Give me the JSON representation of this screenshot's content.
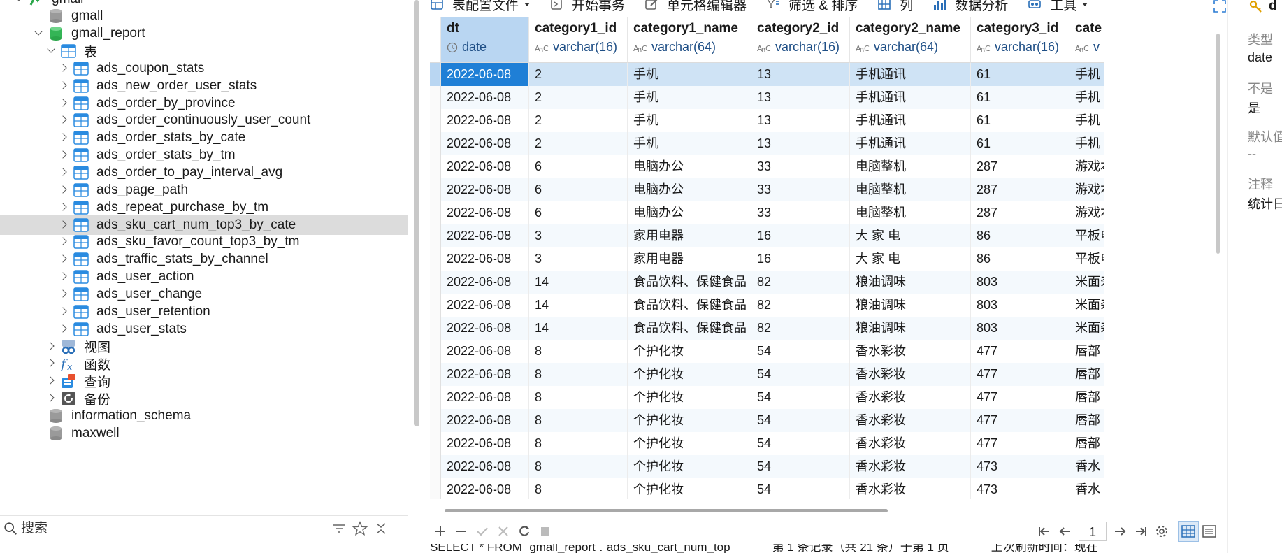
{
  "navigator": {
    "items": [
      {
        "label": "gmall",
        "level": 0,
        "icon": "connection-icon",
        "chevron": "down",
        "partial": true
      },
      {
        "label": "gmall",
        "level": 1,
        "icon": "database-icon",
        "chevron": "none"
      },
      {
        "label": "gmall_report",
        "level": 1,
        "icon": "database-active-icon",
        "chevron": "down"
      },
      {
        "label": "表",
        "level": 2,
        "icon": "tables-folder-icon",
        "chevron": "down"
      },
      {
        "label": "ads_coupon_stats",
        "level": 3,
        "icon": "table-icon",
        "chevron": "right"
      },
      {
        "label": "ads_new_order_user_stats",
        "level": 3,
        "icon": "table-icon",
        "chevron": "right"
      },
      {
        "label": "ads_order_by_province",
        "level": 3,
        "icon": "table-icon",
        "chevron": "right"
      },
      {
        "label": "ads_order_continuously_user_count",
        "level": 3,
        "icon": "table-icon",
        "chevron": "right"
      },
      {
        "label": "ads_order_stats_by_cate",
        "level": 3,
        "icon": "table-icon",
        "chevron": "right"
      },
      {
        "label": "ads_order_stats_by_tm",
        "level": 3,
        "icon": "table-icon",
        "chevron": "right"
      },
      {
        "label": "ads_order_to_pay_interval_avg",
        "level": 3,
        "icon": "table-icon",
        "chevron": "right"
      },
      {
        "label": "ads_page_path",
        "level": 3,
        "icon": "table-icon",
        "chevron": "right"
      },
      {
        "label": "ads_repeat_purchase_by_tm",
        "level": 3,
        "icon": "table-icon",
        "chevron": "right"
      },
      {
        "label": "ads_sku_cart_num_top3_by_cate",
        "level": 3,
        "icon": "table-icon",
        "chevron": "right",
        "selected": true
      },
      {
        "label": "ads_sku_favor_count_top3_by_tm",
        "level": 3,
        "icon": "table-icon",
        "chevron": "right"
      },
      {
        "label": "ads_traffic_stats_by_channel",
        "level": 3,
        "icon": "table-icon",
        "chevron": "right"
      },
      {
        "label": "ads_user_action",
        "level": 3,
        "icon": "table-icon",
        "chevron": "right"
      },
      {
        "label": "ads_user_change",
        "level": 3,
        "icon": "table-icon",
        "chevron": "right"
      },
      {
        "label": "ads_user_retention",
        "level": 3,
        "icon": "table-icon",
        "chevron": "right"
      },
      {
        "label": "ads_user_stats",
        "level": 3,
        "icon": "table-icon",
        "chevron": "right"
      },
      {
        "label": "视图",
        "level": 2,
        "icon": "views-icon",
        "chevron": "right"
      },
      {
        "label": "函数",
        "level": 2,
        "icon": "function-icon",
        "chevron": "right"
      },
      {
        "label": "查询",
        "level": 2,
        "icon": "query-icon",
        "chevron": "right"
      },
      {
        "label": "备份",
        "level": 2,
        "icon": "backup-icon",
        "chevron": "right"
      },
      {
        "label": "information_schema",
        "level": 1,
        "icon": "database-icon",
        "chevron": "none"
      },
      {
        "label": "maxwell",
        "level": 1,
        "icon": "database-icon",
        "chevron": "none"
      }
    ],
    "search_placeholder": "搜索"
  },
  "toolbar": {
    "items": [
      {
        "label": "表配置文件",
        "icon": "table-config-icon",
        "dropdown": true
      },
      {
        "label": "开始事务",
        "icon": "transaction-icon",
        "dropdown": false
      },
      {
        "label": "单元格编辑器",
        "icon": "cell-editor-icon",
        "dropdown": false
      },
      {
        "label": "筛选 & 排序",
        "icon": "filter-sort-icon",
        "dropdown": false
      },
      {
        "label": "列",
        "icon": "columns-icon",
        "dropdown": false
      },
      {
        "label": "数据分析",
        "icon": "data-analysis-icon",
        "dropdown": false
      },
      {
        "label": "工具",
        "icon": "tools-icon",
        "dropdown": true
      }
    ]
  },
  "grid": {
    "columns": [
      {
        "name": "dt",
        "type": "date",
        "type_icon": "clock-icon"
      },
      {
        "name": "category1_id",
        "type": "varchar(16)",
        "type_icon": "abc-icon"
      },
      {
        "name": "category1_name",
        "type": "varchar(64)",
        "type_icon": "abc-icon"
      },
      {
        "name": "category2_id",
        "type": "varchar(16)",
        "type_icon": "abc-icon"
      },
      {
        "name": "category2_name",
        "type": "varchar(64)",
        "type_icon": "abc-icon"
      },
      {
        "name": "category3_id",
        "type": "varchar(16)",
        "type_icon": "abc-icon"
      },
      {
        "name": "cate",
        "type": "v",
        "type_icon": "abc-icon"
      }
    ],
    "rows": [
      [
        "2022-06-08",
        "2",
        "手机",
        "13",
        "手机通讯",
        "61",
        "手机"
      ],
      [
        "2022-06-08",
        "2",
        "手机",
        "13",
        "手机通讯",
        "61",
        "手机"
      ],
      [
        "2022-06-08",
        "2",
        "手机",
        "13",
        "手机通讯",
        "61",
        "手机"
      ],
      [
        "2022-06-08",
        "2",
        "手机",
        "13",
        "手机通讯",
        "61",
        "手机"
      ],
      [
        "2022-06-08",
        "6",
        "电脑办公",
        "33",
        "电脑整机",
        "287",
        "游戏本"
      ],
      [
        "2022-06-08",
        "6",
        "电脑办公",
        "33",
        "电脑整机",
        "287",
        "游戏本"
      ],
      [
        "2022-06-08",
        "6",
        "电脑办公",
        "33",
        "电脑整机",
        "287",
        "游戏本"
      ],
      [
        "2022-06-08",
        "3",
        "家用电器",
        "16",
        "大 家 电",
        "86",
        "平板电"
      ],
      [
        "2022-06-08",
        "3",
        "家用电器",
        "16",
        "大 家 电",
        "86",
        "平板电"
      ],
      [
        "2022-06-08",
        "14",
        "食品饮料、保健食品",
        "82",
        "粮油调味",
        "803",
        "米面杂"
      ],
      [
        "2022-06-08",
        "14",
        "食品饮料、保健食品",
        "82",
        "粮油调味",
        "803",
        "米面杂"
      ],
      [
        "2022-06-08",
        "14",
        "食品饮料、保健食品",
        "82",
        "粮油调味",
        "803",
        "米面杂"
      ],
      [
        "2022-06-08",
        "8",
        "个护化妆",
        "54",
        "香水彩妆",
        "477",
        "唇部"
      ],
      [
        "2022-06-08",
        "8",
        "个护化妆",
        "54",
        "香水彩妆",
        "477",
        "唇部"
      ],
      [
        "2022-06-08",
        "8",
        "个护化妆",
        "54",
        "香水彩妆",
        "477",
        "唇部"
      ],
      [
        "2022-06-08",
        "8",
        "个护化妆",
        "54",
        "香水彩妆",
        "477",
        "唇部"
      ],
      [
        "2022-06-08",
        "8",
        "个护化妆",
        "54",
        "香水彩妆",
        "477",
        "唇部"
      ],
      [
        "2022-06-08",
        "8",
        "个护化妆",
        "54",
        "香水彩妆",
        "473",
        "香水"
      ],
      [
        "2022-06-08",
        "8",
        "个护化妆",
        "54",
        "香水彩妆",
        "473",
        "香水"
      ]
    ],
    "selected_row": 0
  },
  "pager": {
    "page": "1"
  },
  "status": {
    "sql": "SELECT * FROM `gmall_report`.`ads_sku_cart_num_top",
    "records": "第 1 条记录（共 21 条）于第 1 页",
    "refresh": "上次刷新时间：现在"
  },
  "properties": {
    "title": "d",
    "type_label": "类型",
    "type_value": "date",
    "not_null_label": "不是",
    "not_null_value": "是",
    "default_label": "默认值",
    "default_value": "--",
    "comment_label": "注释",
    "comment_value": "统计日"
  },
  "colors": {
    "selection": "#cfe3f5",
    "active_cell": "#1f7fd6",
    "header_selected": "#b9d6f2",
    "tree_selected": "#dcdcdc"
  }
}
